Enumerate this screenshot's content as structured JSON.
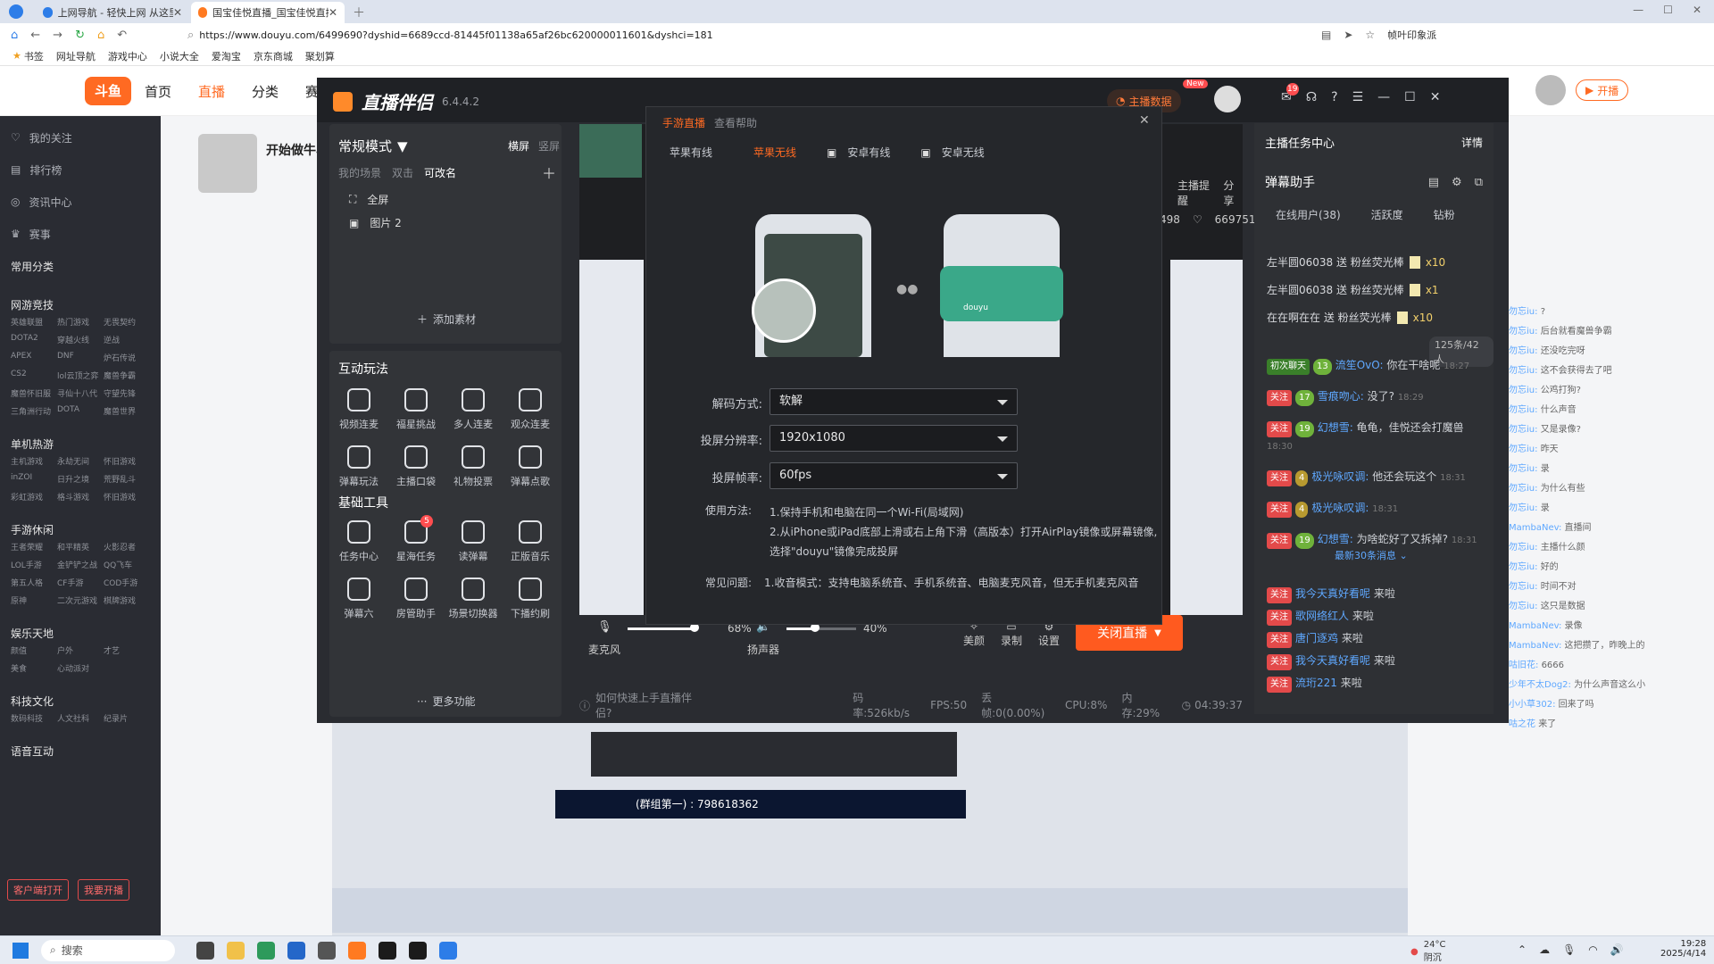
{
  "browser": {
    "tabs": [
      {
        "title": "上网导航 - 轻快上网 从这里开"
      },
      {
        "title": "国宝佳悦直播_国宝佳悦直播_斗"
      }
    ],
    "url": "https://www.douyu.com/6499690?dyshid=6689ccd-81445f01138a65af26bc620000011601&dyshci=181",
    "bookmarks": [
      "书签",
      "网址导航",
      "游戏中心",
      "小说大全",
      "爱淘宝",
      "京东商城",
      "聚划算"
    ],
    "ad_text": "帧叶印象派"
  },
  "douyu": {
    "logo": "斗鱼",
    "nav": [
      "首页",
      "直播",
      "分类",
      "赛事"
    ],
    "open_live": "开播",
    "left_nav": {
      "top_items": [
        "我的关注",
        "排行榜",
        "资讯中心",
        "赛事"
      ],
      "common": "常用分类",
      "sections": [
        {
          "title": "网游竞技",
          "items": [
            "英雄联盟",
            "热门游戏",
            "无畏契约",
            "DOTA2",
            "穿越火线",
            "逆战",
            "APEX",
            "DNF",
            "炉石传说",
            "CS2",
            "lol云顶之弈",
            "魔兽争霸",
            "魔兽怀旧服",
            "寻仙十八代",
            "守望先锋",
            "三角洲行动",
            "DOTA",
            "魔兽世界"
          ]
        },
        {
          "title": "单机热游",
          "items": [
            "主机游戏",
            "永劫无间",
            "怀旧游戏",
            "inZOI",
            "日升之境",
            "荒野乱斗",
            "彩虹游戏",
            "格斗游戏",
            "怀旧游戏"
          ]
        },
        {
          "title": "手游休闲",
          "items": [
            "王者荣耀",
            "和平精英",
            "火影忍者",
            "LOL手游",
            "金铲铲之战",
            "QQ飞车",
            "第五人格",
            "CF手游",
            "COD手游",
            "原神",
            "二次元游戏",
            "棋牌游戏"
          ]
        },
        {
          "title": "娱乐天地",
          "items": [
            "颜值",
            "户外",
            "才艺",
            "美食",
            "心动派对"
          ]
        },
        {
          "title": "科技文化",
          "items": [
            "数码科技",
            "人文社科",
            "纪录片"
          ]
        },
        {
          "title": "语音互动"
        }
      ],
      "bottom_buttons": [
        "客户端打开",
        "我要开播"
      ]
    },
    "streamer_title": "开始做牛马",
    "stats": {
      "followers": "669751",
      "viewers": "498"
    },
    "actions": [
      "主播提醒",
      "分享"
    ]
  },
  "app": {
    "title": "直播伴侣",
    "version": "6.4.4.2",
    "mode": "常规模式",
    "orientation": [
      "横屏",
      "竖屏"
    ],
    "scene_tabs": [
      "我的场景",
      "双击",
      "可改名"
    ],
    "scenes": [
      "全屏",
      "图片 2"
    ],
    "add_material": "添加素材",
    "interactive_title": "互动玩法",
    "interactive_tools": [
      "视频连麦",
      "福星挑战",
      "多人连麦",
      "观众连麦",
      "弹幕玩法",
      "主播口袋",
      "礼物投票",
      "弹幕点歌"
    ],
    "basic_title": "基础工具",
    "basic_tools": [
      "任务中心",
      "星海任务",
      "读弹幕",
      "正版音乐",
      "弹幕六",
      "房管助手",
      "场景切换器",
      "下播约刷"
    ],
    "basic_badge": "5",
    "more": "更多功能",
    "top_right": {
      "data_btn": "主播数据",
      "new_badge": "New",
      "msg_badge": "19"
    },
    "mic_label": "麦克风",
    "mic_volume": "68%",
    "speaker_label": "扬声器",
    "speaker_volume": "40%",
    "bottom_icons": [
      "美颜",
      "录制",
      "设置"
    ],
    "stop_button": "关闭直播",
    "status": {
      "tip": "如何快速上手直播伴侣?",
      "bitrate": "码率:526kb/s",
      "fps": "FPS:50",
      "dropped": "丢帧:0(0.00%)",
      "cpu": "CPU:8%",
      "mem": "内存:29%",
      "time": "04:39:37"
    }
  },
  "dialog": {
    "tabs": [
      "手游直播",
      "查看帮助"
    ],
    "methods": [
      "苹果有线",
      "苹果无线",
      "安卓有线",
      "安卓无线"
    ],
    "active_method": "苹果无线",
    "fields": [
      {
        "label": "解码方式:",
        "value": "软解"
      },
      {
        "label": "投屏分辨率:",
        "value": "1920x1080"
      },
      {
        "label": "投屏帧率:",
        "value": "60fps"
      }
    ],
    "usage_label": "使用方法:",
    "usage_lines": [
      "1.保持手机和电脑在同一个Wi-Fi(局域网)",
      "2.从iPhone或iPad底部上滑或右上角下滑（高版本）打开AirPlay镜像或屏幕镜像,",
      "选择\"douyu\"镜像完成投屏"
    ],
    "faq_label": "常见问题:",
    "faq_text": "1.收音模式：支持电脑系统音、手机系统音、电脑麦克风音，但无手机麦克风音",
    "phone_label": "douyu"
  },
  "chat": {
    "task_center": "主播任务中心",
    "details": "详情",
    "assistant": "弹幕助手",
    "tabs": [
      "在线用户(38)",
      "活跃度",
      "钻粉"
    ],
    "gifts": [
      {
        "text": "左半圆06038 送 粉丝荧光棒",
        "count": "x10"
      },
      {
        "text": "左半圆06038 送 粉丝荧光棒",
        "count": "x1"
      },
      {
        "text": "在在啊在在 送 粉丝荧光棒",
        "count": "x10"
      }
    ],
    "count_pill": "125条/42人",
    "messages": [
      {
        "tag": "初次聊天",
        "lvl": "13",
        "nick": "流笙OvO:",
        "text": "你在干啥呢",
        "time": "18:27"
      },
      {
        "tag": "关注",
        "lvl": "17",
        "nick": "雪痕吻心:",
        "text": "没了?",
        "time": "18:29"
      },
      {
        "tag": "关注",
        "lvl": "19",
        "nick": "幻想雪:",
        "text": "龟龟，佳悦还会打魔兽",
        "time": "18:30"
      },
      {
        "tag": "关注",
        "lvl": "4",
        "nick": "极光咏叹调:",
        "text": "他还会玩这个",
        "time": "18:31"
      },
      {
        "tag": "关注",
        "lvl": "4",
        "nick": "极光咏叹调:",
        "text": "",
        "time": "18:31"
      },
      {
        "tag": "关注",
        "lvl": "19",
        "nick": "幻想雪:",
        "text": "为啥蛇好了又拆掉?",
        "time": "18:31"
      }
    ],
    "latest": "最新30条消息",
    "entries": [
      {
        "tag": "关注",
        "nick": "我今天真好看呢",
        "text": "来啦"
      },
      {
        "tag": "关注",
        "nick": "歌网络红人",
        "text": "来啦"
      },
      {
        "tag": "关注",
        "nick": "唐门逐鸡",
        "text": "来啦"
      },
      {
        "tag": "关注",
        "nick": "我今天真好看呢",
        "text": "来啦"
      },
      {
        "tag": "关注",
        "nick": "流珩221",
        "text": "来啦"
      }
    ]
  },
  "side_chat": [
    {
      "nick": "勿忘iu:",
      "text": "?"
    },
    {
      "nick": "勿忘iu:",
      "text": "后台就看魔兽争霸"
    },
    {
      "nick": "勿忘iu:",
      "text": "还没吃完呀"
    },
    {
      "nick": "勿忘iu:",
      "text": "这不会获得去了吧"
    },
    {
      "nick": "勿忘iu:",
      "text": "公鸡打狗?"
    },
    {
      "nick": "勿忘iu:",
      "text": "什么声音"
    },
    {
      "nick": "勿忘iu:",
      "text": "又是录像?"
    },
    {
      "nick": "勿忘iu:",
      "text": "昨天"
    },
    {
      "nick": "勿忘iu:",
      "text": "录"
    },
    {
      "nick": "勿忘iu:",
      "text": "为什么有些"
    },
    {
      "nick": "勿忘iu:",
      "text": "录"
    },
    {
      "nick": "MambaNev:",
      "text": "直播间"
    },
    {
      "nick": "勿忘iu:",
      "text": "主播什么颜"
    },
    {
      "nick": "勿忘iu:",
      "text": "好的"
    },
    {
      "nick": "勿忘iu:",
      "text": "时间不对"
    },
    {
      "nick": "勿忘iu:",
      "text": "这只是数据"
    },
    {
      "nick": "MambaNev:",
      "text": "录像"
    },
    {
      "nick": "MambaNev:",
      "text": "这把攒了，昨晚上的"
    },
    {
      "nick": "咕旧花:",
      "text": "6666"
    },
    {
      "nick": "少年不太Dog2:",
      "text": "为什么声音这么小"
    },
    {
      "nick": "小小草302:",
      "text": "回来了吗"
    },
    {
      "nick": "咕之花",
      "text": "来了"
    }
  ],
  "stream_overlay": {
    "text": "(群组第一) : 798618362"
  },
  "taskbar": {
    "search": "搜索",
    "weather": "24°C",
    "weather_desc": "阴沉",
    "time": "19:28",
    "date": "2025/4/14"
  }
}
